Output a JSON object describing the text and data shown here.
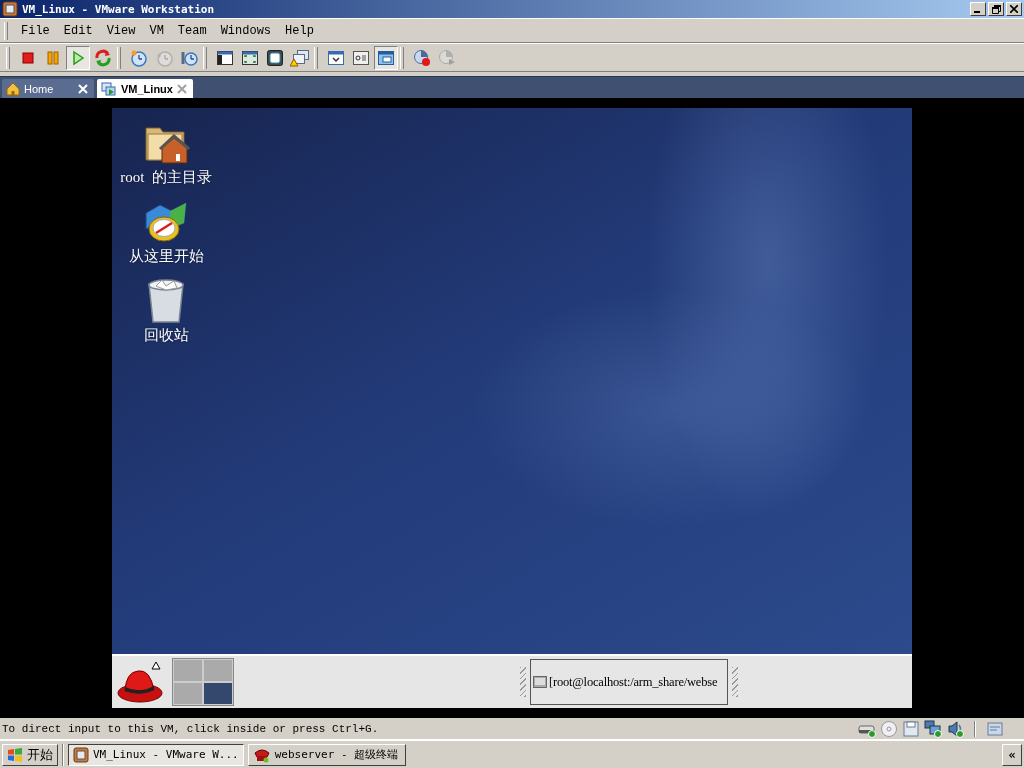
{
  "window": {
    "title": "VM_Linux - VMware Workstation"
  },
  "menu": [
    "File",
    "Edit",
    "View",
    "VM",
    "Team",
    "Windows",
    "Help"
  ],
  "toolbar": {
    "groups": [
      [
        {
          "kind": "stop",
          "pressed": false,
          "disabled": false
        },
        {
          "kind": "pause",
          "pressed": false,
          "disabled": false
        },
        {
          "kind": "play",
          "pressed": true,
          "disabled": false
        },
        {
          "kind": "reset",
          "pressed": false,
          "disabled": false
        }
      ],
      [
        {
          "kind": "snapshot",
          "pressed": false,
          "disabled": false
        },
        {
          "kind": "revert",
          "pressed": false,
          "disabled": true
        },
        {
          "kind": "manager",
          "pressed": false,
          "disabled": false
        }
      ],
      [
        {
          "kind": "console",
          "pressed": false,
          "disabled": false
        },
        {
          "kind": "fullscreen",
          "pressed": false,
          "disabled": false
        },
        {
          "kind": "quickswitch",
          "pressed": false,
          "disabled": false
        },
        {
          "kind": "windows",
          "pressed": false,
          "disabled": false
        }
      ],
      [
        {
          "kind": "settings",
          "pressed": false,
          "disabled": false
        },
        {
          "kind": "summary",
          "pressed": false,
          "disabled": false
        },
        {
          "kind": "appliance",
          "pressed": true,
          "disabled": false
        }
      ],
      [
        {
          "kind": "record",
          "pressed": false,
          "disabled": false
        },
        {
          "kind": "replay",
          "pressed": false,
          "disabled": true
        }
      ]
    ]
  },
  "tabs": [
    {
      "label": "Home",
      "kind": "home",
      "selected": false
    },
    {
      "label": "VM_Linux",
      "kind": "vm",
      "selected": true
    }
  ],
  "guest": {
    "desktop_icons": [
      {
        "label": "root  的主目录",
        "kind": "home"
      },
      {
        "label": "从这里开始",
        "kind": "start"
      },
      {
        "label": "回收站",
        "kind": "trash"
      }
    ],
    "panel": {
      "workspaces": [
        {
          "selected": false
        },
        {
          "selected": false
        },
        {
          "selected": false
        },
        {
          "selected": true
        }
      ],
      "task": {
        "label": "[root@localhost:/arm_share/webse"
      }
    }
  },
  "status_bar": {
    "message": "To direct input to this VM, click inside or press Ctrl+G.",
    "devices": [
      {
        "kind": "disk",
        "connected": true
      },
      {
        "kind": "cdrom",
        "connected": false
      },
      {
        "kind": "floppy",
        "connected": false
      },
      {
        "kind": "network",
        "connected": true
      },
      {
        "kind": "sound",
        "connected": true
      }
    ]
  },
  "taskbar": {
    "start": "开始",
    "tasks": [
      {
        "label": "VM_Linux - VMware W...",
        "kind": "vmware",
        "selected": true
      },
      {
        "label": "webserver - 超级终端",
        "kind": "terminal",
        "selected": false
      }
    ],
    "expand": "«"
  }
}
